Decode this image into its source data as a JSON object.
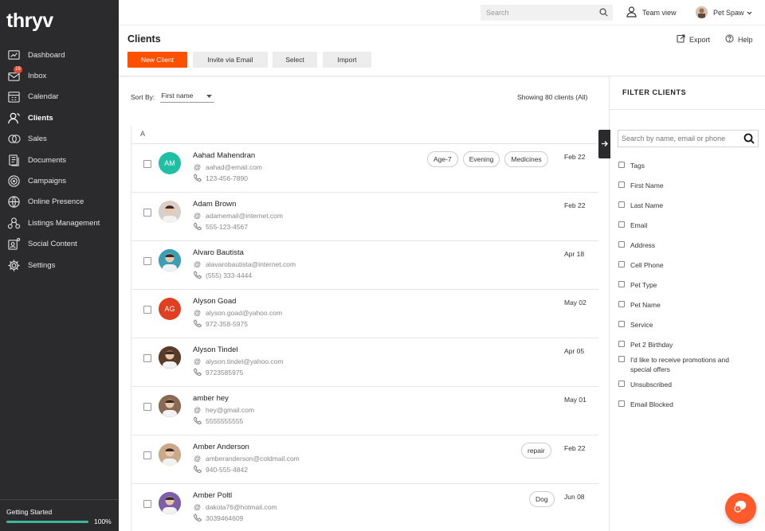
{
  "brand": {
    "logo": "thryv"
  },
  "sidebar": {
    "items": [
      {
        "label": "Dashboard",
        "icon": "dashboard-icon"
      },
      {
        "label": "Inbox",
        "icon": "inbox-icon",
        "badge": "19"
      },
      {
        "label": "Calendar",
        "icon": "calendar-icon"
      },
      {
        "label": "Clients",
        "icon": "clients-icon",
        "active": true
      },
      {
        "label": "Sales",
        "icon": "sales-icon"
      },
      {
        "label": "Documents",
        "icon": "documents-icon"
      },
      {
        "label": "Campaigns",
        "icon": "campaigns-icon"
      },
      {
        "label": "Online Presence",
        "icon": "globe-icon"
      },
      {
        "label": "Listings Management",
        "icon": "listings-icon"
      },
      {
        "label": "Social Content",
        "icon": "social-icon"
      },
      {
        "label": "Settings",
        "icon": "gear-icon"
      }
    ],
    "getting_started": {
      "label": "Getting Started",
      "percent_label": "100%",
      "progress": 1.0
    }
  },
  "topbar": {
    "search_placeholder": "Search",
    "team_view": "Team view",
    "user_name": "Pet Spaw"
  },
  "page": {
    "title": "Clients",
    "buttons": {
      "new_client": "New Client",
      "invite": "Invite via Email",
      "select": "Select",
      "import": "Import"
    },
    "export": "Export",
    "help": "Help",
    "sort_by_label": "Sort By:",
    "sort_by_value": "First name",
    "showing": "Showing 80 clients (All)",
    "section_letter": "A"
  },
  "clients": [
    {
      "name": "Aahad Mahendran",
      "email": "aahad@email.com",
      "phone": "123-456-7890",
      "date": "Feb 22",
      "initials": "AM",
      "avatar_color": "#1fbfa3",
      "tags": [
        "Age-7",
        "Evening",
        "Medicines"
      ]
    },
    {
      "name": "Adam Brown",
      "email": "adamemail@internet.com",
      "phone": "555-123-4567",
      "date": "Feb 22",
      "initials": "",
      "avatar_color": "#d9cfc8",
      "tags": []
    },
    {
      "name": "Alvaro Bautista",
      "email": "alavarobautista@internet.com",
      "phone": "(555) 333-4444",
      "date": "Apr 18",
      "initials": "",
      "avatar_color": "#3a9fb5",
      "tags": []
    },
    {
      "name": "Alyson Goad",
      "email": "alyson.goad@yahoo.com",
      "phone": "972-358-5975",
      "date": "May 02",
      "initials": "AG",
      "avatar_color": "#e0401f",
      "tags": []
    },
    {
      "name": "Alyson Tindel",
      "email": "alyson.tindel@yahoo.com",
      "phone": "9723585975",
      "date": "Apr 05",
      "initials": "",
      "avatar_color": "#5a3a28",
      "tags": []
    },
    {
      "name": "amber hey",
      "email": "hey@gmail.com",
      "phone": "5555555555",
      "date": "May 01",
      "initials": "",
      "avatar_color": "#8a6a55",
      "tags": []
    },
    {
      "name": "Amber Anderson",
      "email": "amberanderson@coldmail.com",
      "phone": "940-555-4842",
      "date": "Feb 22",
      "initials": "",
      "avatar_color": "#c9a98a",
      "tags": [
        "repair"
      ]
    },
    {
      "name": "Amber Poltl",
      "email": "dakota76@hotmail.com",
      "phone": "3039464609",
      "date": "Jun 08",
      "initials": "",
      "avatar_color": "#7d5ea8",
      "tags": [
        "Dog"
      ]
    }
  ],
  "filter": {
    "title": "FILTER CLIENTS",
    "search_placeholder": "Search by name, email or phone",
    "options": [
      "Tags",
      "First Name",
      "Last Name",
      "Email",
      "Address",
      "Cell Phone",
      "Pet Type",
      "Pet Name",
      "Service",
      "Pet 2 Birthday",
      "I'd like to receive promotions and special offers",
      "Unsubscribed",
      "Email Blocked"
    ]
  },
  "colors": {
    "accent": "#ff5000",
    "sidebar_bg": "#2b2b2d",
    "progress": "#3ab89a"
  }
}
